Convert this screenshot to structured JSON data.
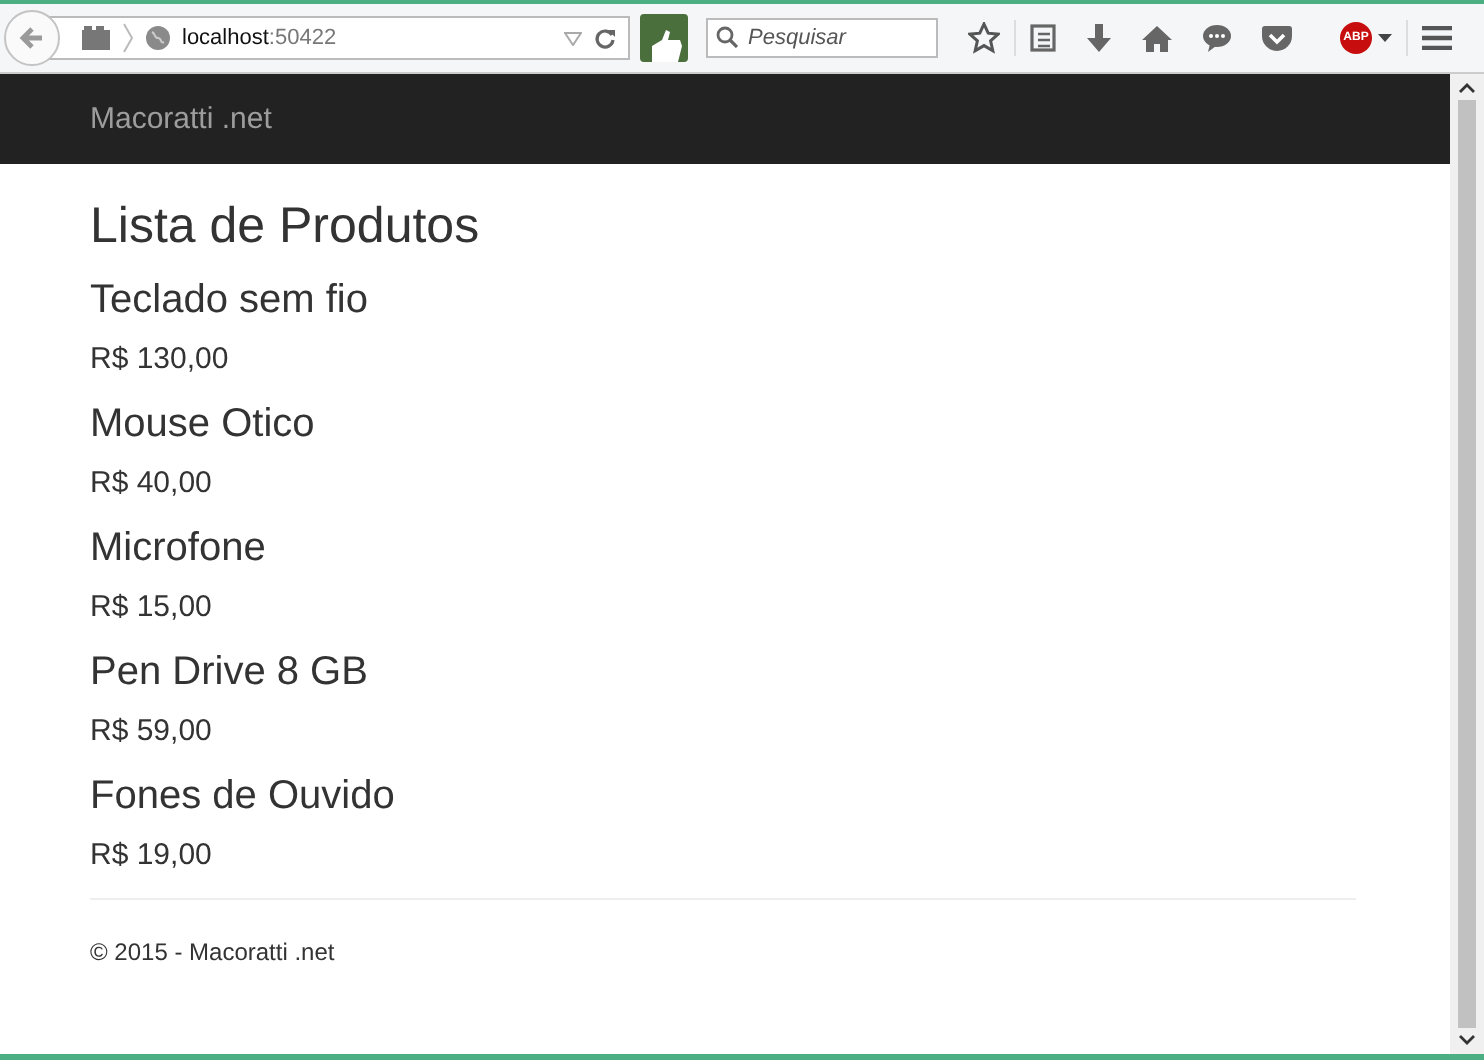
{
  "browser": {
    "url_host": "localhost",
    "url_port": ":50422",
    "search": {
      "placeholder": "Pesquisar"
    },
    "adblock_badge": "ABP"
  },
  "navbar": {
    "brand": "Macoratti .net"
  },
  "page": {
    "title": "Lista de Produtos",
    "products": [
      {
        "name": "Teclado sem fio",
        "price": "R$ 130,00"
      },
      {
        "name": "Mouse Otico",
        "price": "R$ 40,00"
      },
      {
        "name": "Microfone",
        "price": "R$ 15,00"
      },
      {
        "name": "Pen Drive 8 GB",
        "price": "R$ 59,00"
      },
      {
        "name": "Fones de Ouvido",
        "price": "R$ 19,00"
      }
    ],
    "footer": "© 2015 - Macoratti .net"
  }
}
